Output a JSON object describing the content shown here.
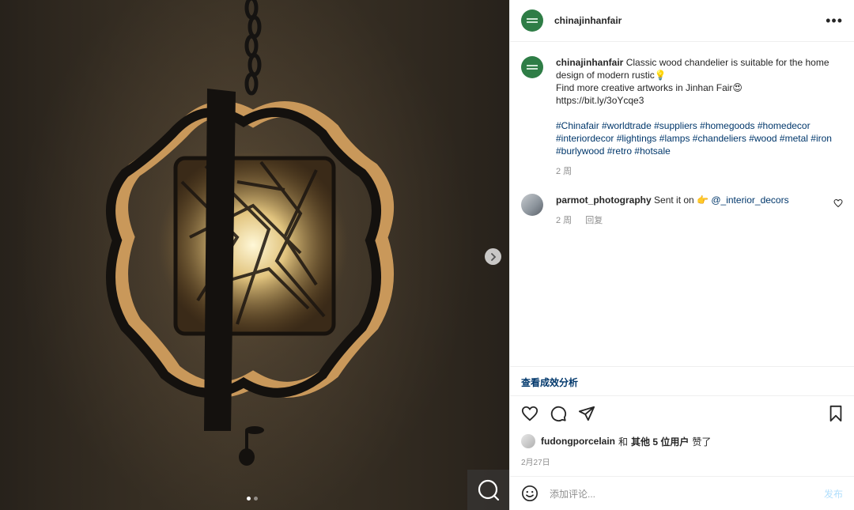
{
  "post": {
    "username": "chinajinhanfair",
    "more_label": "•••"
  },
  "caption": {
    "username": "chinajinhanfair",
    "text_line1": "Classic wood chandelier is suitable for the home design of modern rustic",
    "text_line2": "Find more creative artworks in Jinhan Fair",
    "link": "https://bit.ly/3oYcqe3",
    "hashtags": [
      "#Chinafair",
      "#worldtrade",
      "#suppliers",
      "#homegoods",
      "#homedecor",
      "#interiordecor",
      "#lightings",
      "#lamps",
      "#chandeliers",
      "#wood",
      "#metal",
      "#iron",
      "#burlywood",
      "#retro",
      "#hotsale"
    ],
    "time": "2 周"
  },
  "comment": {
    "username": "parmot_photography",
    "text": "Sent it on",
    "mention": "@_interior_decors",
    "time": "2 周",
    "reply_label": "回复"
  },
  "insights_label": "查看成效分析",
  "likes": {
    "user": "fudongporcelain",
    "conjunction": "和",
    "others": "其他 5 位用户",
    "suffix": "赞了"
  },
  "date": "2月27日",
  "add_comment": {
    "placeholder": "添加评论...",
    "post_label": "发布"
  },
  "carousel": {
    "current": 1,
    "total": 2
  },
  "colors": {
    "link": "#00376b",
    "brand_avatar": "#2e7d46",
    "muted": "#8e8e8e",
    "post_disabled": "#b2dffc"
  }
}
